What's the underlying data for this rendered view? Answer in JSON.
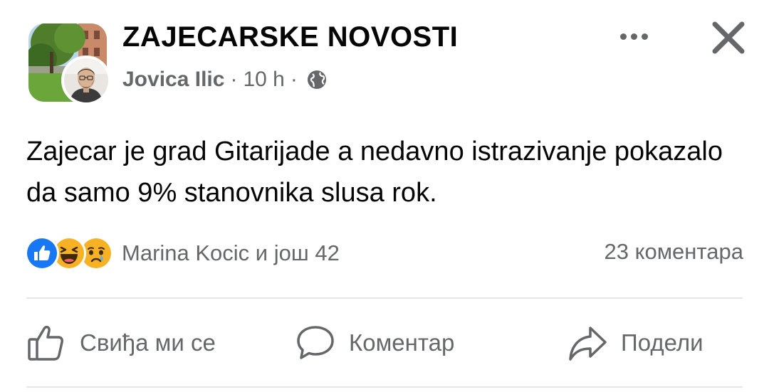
{
  "header": {
    "group_name": "ZAJECARSKE NOVOSTI",
    "author": "Jovica Ilic",
    "separator": "·",
    "time": "10 h",
    "privacy_icon": "globe-icon",
    "more_icon": "more-horizontal-icon",
    "close_icon": "close-icon"
  },
  "post": {
    "text": "Zajecar je grad Gitarijade a nedavno istrazivanje pokazalo da samo 9%  stanovnika slusa rok."
  },
  "reactions": {
    "icons": [
      "like-reaction-icon",
      "haha-reaction-icon",
      "sad-reaction-icon"
    ],
    "summary": "Marina Kocic и још 42",
    "comments": "23 коментара"
  },
  "actions": {
    "like_label": "Свиђа ми се",
    "comment_label": "Коментар",
    "share_label": "Подели"
  },
  "colors": {
    "text_primary": "#050505",
    "text_secondary": "#65676b",
    "like_blue": "#1877f2",
    "emoji_yellow": "#f7b125",
    "divider": "#e4e6eb"
  }
}
